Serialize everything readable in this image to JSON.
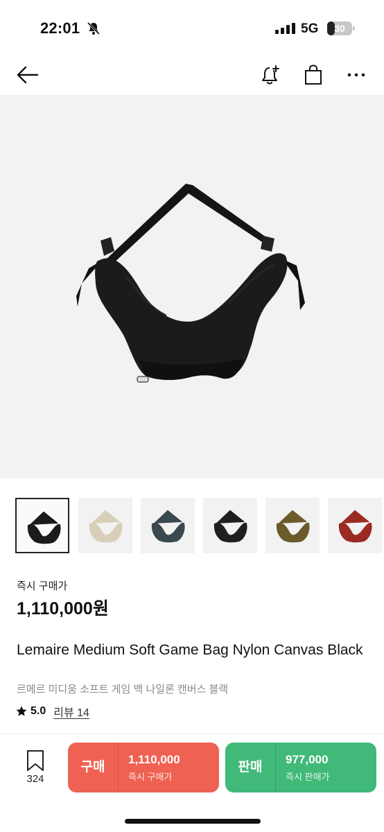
{
  "status_bar": {
    "time": "22:01",
    "network": "5G",
    "battery_level": "30",
    "battery_fraction": 0.3,
    "icons": [
      "bell-off-icon",
      "signal-icon",
      "battery-icon"
    ]
  },
  "nav": {
    "icons": [
      "back-arrow-icon",
      "bell-plus-icon",
      "shopping-bag-icon",
      "more-icon"
    ]
  },
  "product": {
    "image_color": "#1a1a1a",
    "thumbnails": [
      {
        "color_name": "black",
        "color": "#1b1b1b",
        "selected": true
      },
      {
        "color_name": "beige",
        "color": "#d9cfb8",
        "selected": false
      },
      {
        "color_name": "slate",
        "color": "#3a4850",
        "selected": false
      },
      {
        "color_name": "black",
        "color": "#1f1f1f",
        "selected": false
      },
      {
        "color_name": "olive",
        "color": "#6b5a2a",
        "selected": false
      },
      {
        "color_name": "red",
        "color": "#9b2a23",
        "selected": false
      }
    ],
    "price_label": "즉시 구매가",
    "price": "1,110,000원",
    "title": "Lemaire Medium Soft Game Bag Nylon Canvas Black",
    "subtitle_ko": "르메르 미디움 소프트 게임 백 나일론 캔버스 블랙",
    "rating": "5.0",
    "review_label": "리뷰 14"
  },
  "bottom_bar": {
    "wishlist_count": "324",
    "buy": {
      "label": "구매",
      "price": "1,110,000",
      "sub": "즉시 구매가",
      "color": "#ef6253"
    },
    "sell": {
      "label": "판매",
      "price": "977,000",
      "sub": "즉시 판매가",
      "color": "#41b979"
    }
  }
}
